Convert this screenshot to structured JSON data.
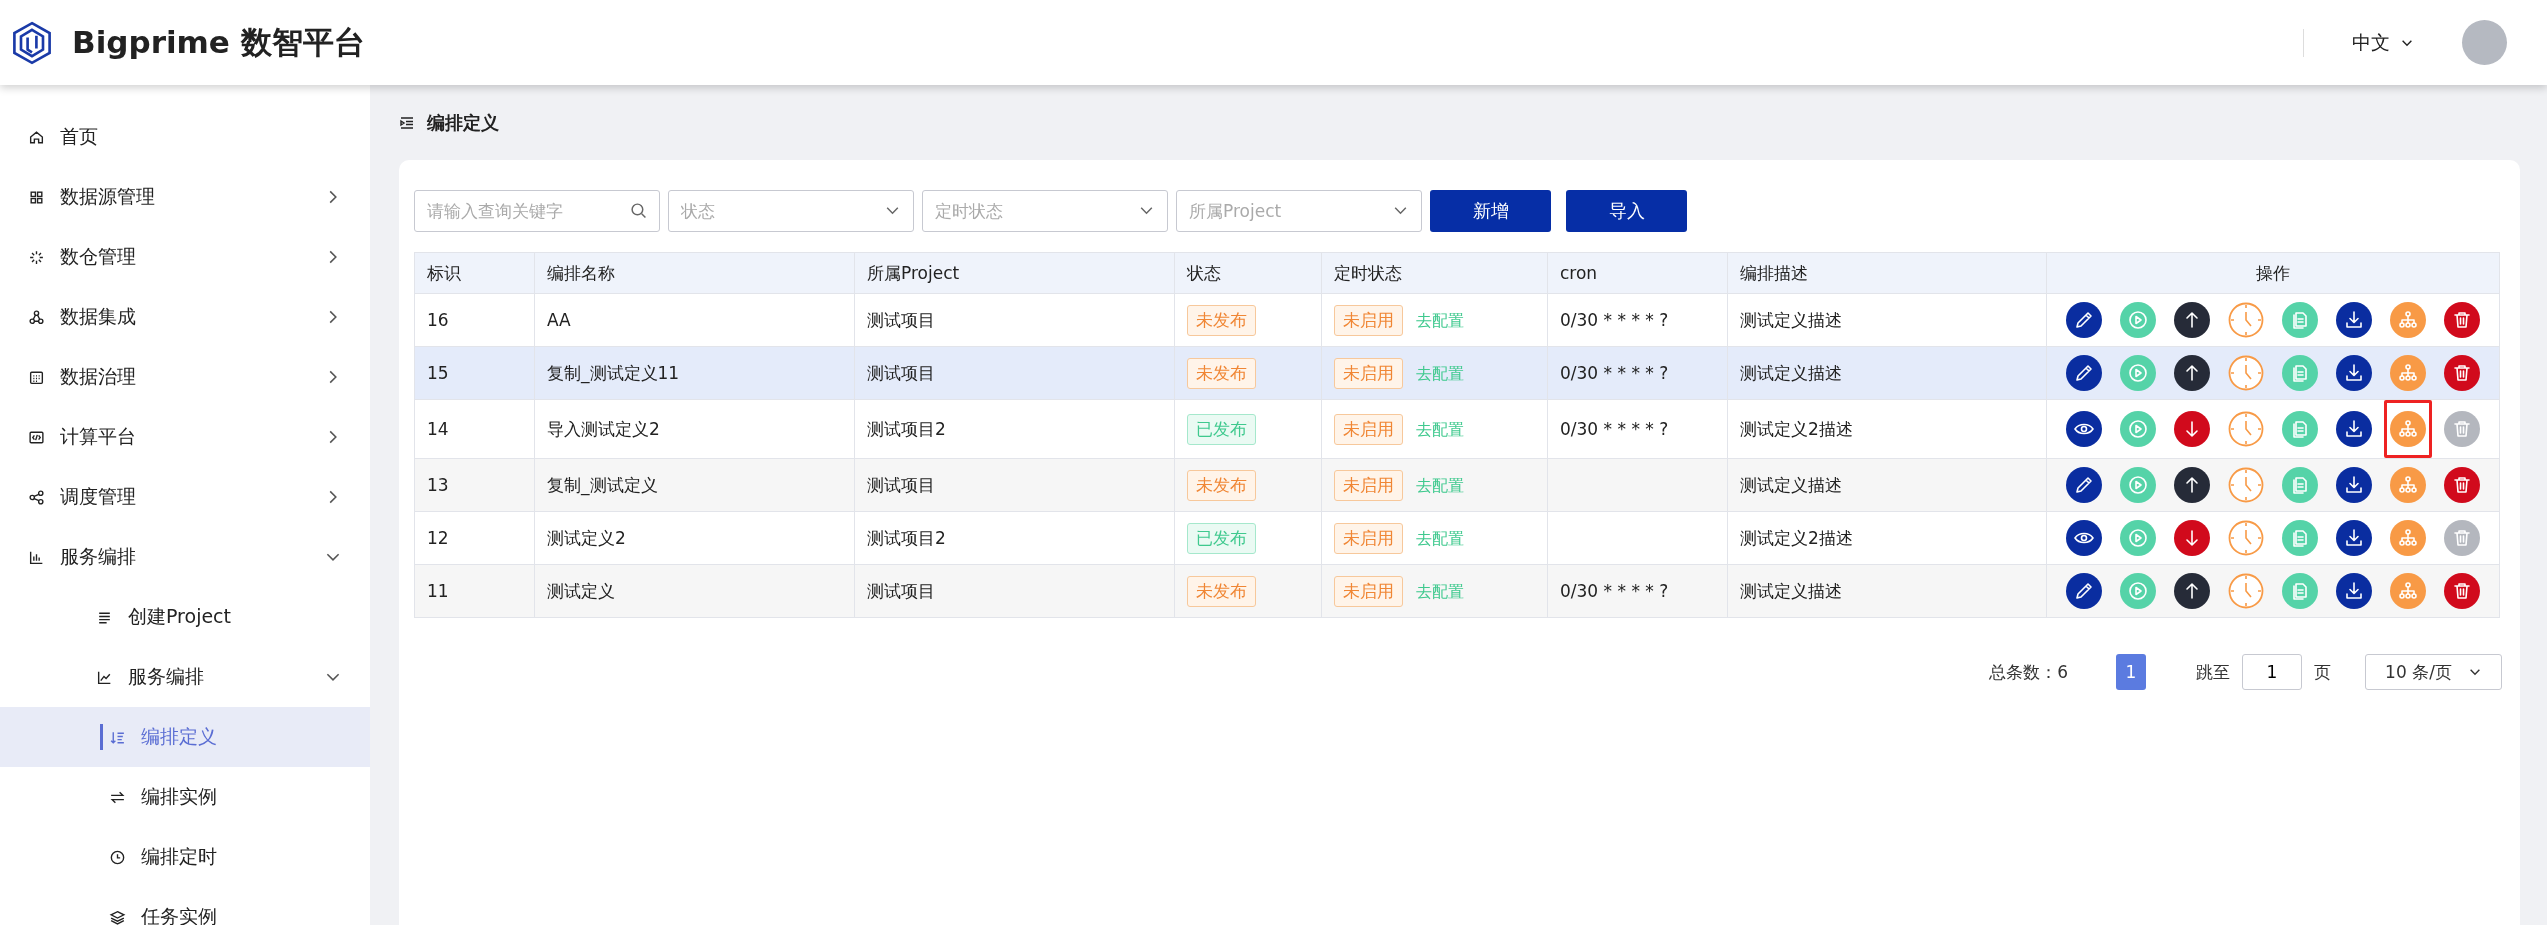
{
  "header": {
    "brand": "Bigprime 数智平台",
    "language": "中文"
  },
  "sidebar": {
    "items": [
      {
        "label": "首页",
        "kind": "link",
        "selected": false
      },
      {
        "label": "数据源管理",
        "kind": "group",
        "expanded": false,
        "selected": false
      },
      {
        "label": "数仓管理",
        "kind": "group",
        "expanded": false,
        "selected": false
      },
      {
        "label": "数据集成",
        "kind": "group",
        "expanded": false,
        "selected": false
      },
      {
        "label": "数据治理",
        "kind": "group",
        "expanded": false,
        "selected": false
      },
      {
        "label": "计算平台",
        "kind": "group",
        "expanded": false,
        "selected": false
      },
      {
        "label": "调度管理",
        "kind": "group",
        "expanded": false,
        "selected": false
      },
      {
        "label": "服务编排",
        "kind": "group",
        "expanded": true,
        "selected": false,
        "children": [
          {
            "label": "创建Project",
            "kind": "link",
            "selected": false
          },
          {
            "label": "服务编排",
            "kind": "group",
            "expanded": true,
            "selected": false,
            "children": [
              {
                "label": "编排定义",
                "selected": true
              },
              {
                "label": "编排实例",
                "selected": false
              },
              {
                "label": "编排定时",
                "selected": false
              },
              {
                "label": "任务实例",
                "selected": false
              }
            ]
          }
        ]
      }
    ]
  },
  "page_title": "编排定义",
  "filters": {
    "search": {
      "placeholder": "请输入查询关键字"
    },
    "selects": [
      {
        "placeholder": "状态"
      },
      {
        "placeholder": "定时状态"
      },
      {
        "placeholder": "所属Project"
      }
    ],
    "buttons": [
      "新增",
      "导入"
    ]
  },
  "table": {
    "columns": [
      "标识",
      "编排名称",
      "所属Project",
      "状态",
      "定时状态",
      "cron",
      "编排描述",
      "操作"
    ],
    "rows": [
      {
        "id": "16",
        "name": "AA",
        "project": "测试项目",
        "status": "未发布",
        "published": false,
        "timer": "未启用",
        "timer_enabled": false,
        "config_link": "去配置",
        "cron": "0/30 * * * * ?",
        "description": "测试定义描述",
        "hovered": false,
        "actions": [
          {
            "kind": "edit",
            "highlighted": false
          },
          {
            "kind": "run",
            "highlighted": false
          },
          {
            "kind": "publish",
            "highlighted": false
          },
          {
            "kind": "schedule",
            "highlighted": false
          },
          {
            "kind": "copy",
            "highlighted": false
          },
          {
            "kind": "export",
            "highlighted": false
          },
          {
            "kind": "flow",
            "highlighted": false
          },
          {
            "kind": "delete",
            "disabled": false,
            "highlighted": false
          }
        ]
      },
      {
        "id": "15",
        "name": "复制_测试定义11",
        "project": "测试项目",
        "status": "未发布",
        "published": false,
        "timer": "未启用",
        "timer_enabled": false,
        "config_link": "去配置",
        "cron": "0/30 * * * * ?",
        "description": "测试定义描述",
        "hovered": true,
        "actions": [
          {
            "kind": "edit",
            "highlighted": false
          },
          {
            "kind": "run",
            "highlighted": false
          },
          {
            "kind": "publish",
            "highlighted": false
          },
          {
            "kind": "schedule",
            "highlighted": false
          },
          {
            "kind": "copy",
            "highlighted": false
          },
          {
            "kind": "export",
            "highlighted": false
          },
          {
            "kind": "flow",
            "highlighted": false
          },
          {
            "kind": "delete",
            "disabled": false,
            "highlighted": false
          }
        ]
      },
      {
        "id": "14",
        "name": "导入测试定义2",
        "project": "测试项目2",
        "status": "已发布",
        "published": true,
        "timer": "未启用",
        "timer_enabled": false,
        "config_link": "去配置",
        "cron": "0/30 * * * * ?",
        "description": "测试定义2描述",
        "hovered": false,
        "actions": [
          {
            "kind": "view",
            "highlighted": false
          },
          {
            "kind": "run",
            "highlighted": false
          },
          {
            "kind": "unpublish",
            "highlighted": false
          },
          {
            "kind": "schedule",
            "highlighted": false
          },
          {
            "kind": "copy",
            "highlighted": false
          },
          {
            "kind": "export",
            "highlighted": false
          },
          {
            "kind": "flow",
            "highlighted": true
          },
          {
            "kind": "delete",
            "disabled": true,
            "highlighted": false
          }
        ]
      },
      {
        "id": "13",
        "name": "复制_测试定义",
        "project": "测试项目",
        "status": "未发布",
        "published": false,
        "timer": "未启用",
        "timer_enabled": false,
        "config_link": "去配置",
        "description": "测试定义描述",
        "hovered": false,
        "actions": [
          {
            "kind": "edit",
            "highlighted": false
          },
          {
            "kind": "run",
            "highlighted": false
          },
          {
            "kind": "publish",
            "highlighted": false
          },
          {
            "kind": "schedule",
            "highlighted": false
          },
          {
            "kind": "copy",
            "highlighted": false
          },
          {
            "kind": "export",
            "highlighted": false
          },
          {
            "kind": "flow",
            "highlighted": false
          },
          {
            "kind": "delete",
            "disabled": false,
            "highlighted": false
          }
        ]
      },
      {
        "id": "12",
        "name": "测试定义2",
        "project": "测试项目2",
        "status": "已发布",
        "published": true,
        "timer": "未启用",
        "timer_enabled": false,
        "config_link": "去配置",
        "description": "测试定义2描述",
        "hovered": false,
        "actions": [
          {
            "kind": "view",
            "highlighted": false
          },
          {
            "kind": "run",
            "highlighted": false
          },
          {
            "kind": "unpublish",
            "highlighted": false
          },
          {
            "kind": "schedule",
            "highlighted": false
          },
          {
            "kind": "copy",
            "highlighted": false
          },
          {
            "kind": "export",
            "highlighted": false
          },
          {
            "kind": "flow",
            "highlighted": false
          },
          {
            "kind": "delete",
            "disabled": true,
            "highlighted": false
          }
        ]
      },
      {
        "id": "11",
        "name": "测试定义",
        "project": "测试项目",
        "status": "未发布",
        "published": false,
        "timer": "未启用",
        "timer_enabled": false,
        "config_link": "去配置",
        "cron": "0/30 * * * * ?",
        "description": "测试定义描述",
        "hovered": false,
        "actions": [
          {
            "kind": "edit",
            "highlighted": false
          },
          {
            "kind": "run",
            "highlighted": false
          },
          {
            "kind": "publish",
            "highlighted": false
          },
          {
            "kind": "schedule",
            "highlighted": false
          },
          {
            "kind": "copy",
            "highlighted": false
          },
          {
            "kind": "export",
            "highlighted": false
          },
          {
            "kind": "flow",
            "highlighted": false
          },
          {
            "kind": "delete",
            "disabled": false,
            "highlighted": false
          }
        ]
      }
    ]
  },
  "pagination": {
    "total": "总条数：6",
    "pages": [
      {
        "label": "1",
        "selected": true
      }
    ],
    "jump_label": "跳至",
    "jump_value": "1",
    "page_unit": "页",
    "page_size": "10 条/页"
  }
}
